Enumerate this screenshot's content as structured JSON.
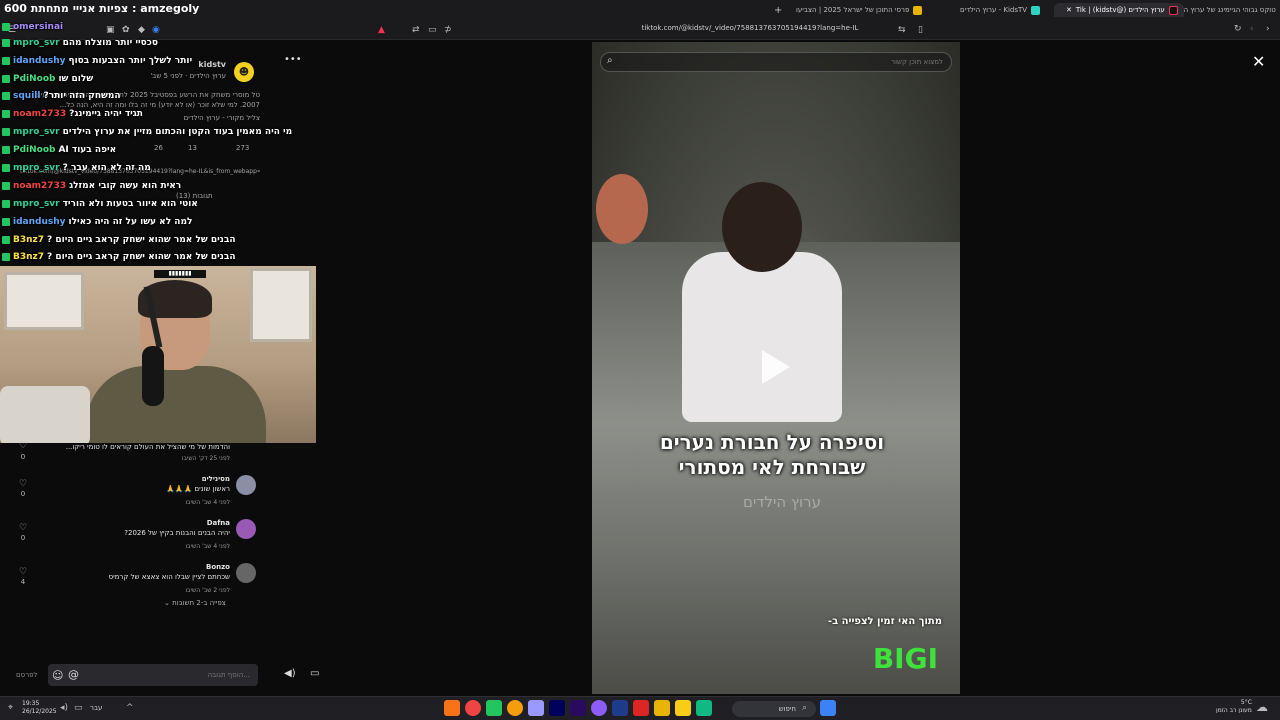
{
  "browser": {
    "stream_title": "amzegoly : צפיות אנייי מתחתת 600",
    "tabs": [
      {
        "label": "טוקס גבוהי הגיימינג של ערוץ הילדים"
      },
      {
        "label": "ערוץ הילדים (@kidstv) | Tik",
        "active": true
      },
      {
        "label": "KidsTV - ערוץ הילדים"
      },
      {
        "label": "פרסי התוכן של ישראל 2025 | הצביעו"
      }
    ],
    "new_tab": "+",
    "url": "tiktok.com/@kidstv/_video/758813763705194419?lang=he-IL"
  },
  "chat": [
    {
      "user": "omersinai",
      "text": "",
      "color": "#a78bfa"
    },
    {
      "user": "mpro_svr",
      "text": "סכסיי יותר מוצלח מהם",
      "color": "#34d399"
    },
    {
      "user": "idandushy",
      "text": "יותר לשלך יותר הצבעות בסוף",
      "color": "#60a5fa"
    },
    {
      "user": "PdiNoob",
      "text": "שלום שו",
      "color": "#4ade80"
    },
    {
      "user": "squill",
      "text": "המשחק הזה יותר?",
      "color": "#60a5fa"
    },
    {
      "user": "noam2733",
      "text": "תגיד יהיה גיימינג?",
      "color": "#ef4444"
    },
    {
      "user": "mpro_svr",
      "text": "מי היה מאמין בעוד הקטן והכתום מזיין את ערוץ הילדים",
      "color": "#34d399"
    },
    {
      "user": "PdiNoob",
      "text": "איפה בעוד AI",
      "color": "#4ade80"
    },
    {
      "user": "mpro_svr",
      "text": "מה זה לא הוא עבר ?",
      "color": "#34d399"
    },
    {
      "user": "noam2733",
      "text": "ראית הוא עשה קובי אמזלג",
      "color": "#ef4444"
    },
    {
      "user": "mpro_svr",
      "text": "אוטי הוא איוור בטעות ולא הוריד",
      "color": "#34d399"
    },
    {
      "user": "idandushy",
      "text": "למה לא עשו על זה היה כאילו",
      "color": "#60a5fa"
    },
    {
      "user": "B3nz7",
      "text": "הבנים של אמר שהוא ישחק קראב גיים היום ?",
      "color": "#fde047"
    },
    {
      "user": "B3nz7",
      "text": "הבנים של אמר שהוא ישחק קראב גיים היום ?",
      "color": "#fde047"
    }
  ],
  "description": {
    "account": "kidstv",
    "subtitle": "ערוץ הילדים · לפני 5 שב'",
    "text": "טל מוסרי משחק את הרשע בפסטיבל 2025 לתוך תוכנית הטלוויזיה ואירועים 2007. למי שלא זוכר (או לא יודע) מי זה בלו ומה זה היא, הנה כל...",
    "sound": "צליל מקורי - ערוץ הילדים",
    "likes": "273",
    "comments": "13",
    "saves": "26",
    "link": "tiktok.com/@kidstv_video/758813763705194419?lang=he-IL&is_from_webapp=1&sender_device=pc&web_id=7475487239276381701",
    "comments_header": "תגובות (13)",
    "more": "•••"
  },
  "webcam_label": "▮▮▮▮▮▮▮",
  "comments": [
    {
      "name": "",
      "text": "והדמות של מי שהציל את העולם קוראים לו טומי ריקו...",
      "meta": "לפני 25 דק'  השיבו",
      "likes": "0",
      "avatar": "#777"
    },
    {
      "name": "מסינילים",
      "text": "ראשון שונים 🙏🙏🙏",
      "meta": "לפני 4 שב'  השיבו",
      "likes": "0",
      "avatar": "#8b8fa6"
    },
    {
      "name": "Dafna",
      "text": "יהיה הבנים והבנות בקיץ של 2026?",
      "meta": "לפני 4 שב'  השיבו",
      "likes": "0",
      "avatar": "#9b59b6"
    },
    {
      "name": "Bonzo",
      "text": "שכחתם לציין שבלו הוא צאצא של קרמיס",
      "meta": "לפני 2 שב'  השיבו",
      "likes": "4",
      "avatar": "#666"
    }
  ],
  "view_replies": "צפייה ב-2 תשובות ⌄",
  "comment_bar": {
    "post": "לפרסם",
    "placeholder": "הוסף תגובה...",
    "emoji": "☺",
    "at": "@"
  },
  "video": {
    "caption": "וסיפרה על חבורת נערים שבורחת לאי מסתורי",
    "watermark": "ערוץ הילדים",
    "promo": "מתוך האי זמין לצפייה ב-",
    "bigi": "BIGI",
    "search_placeholder": "למצוא תוכן קשור"
  },
  "taskbar": {
    "time": "19:35",
    "date": "26/12/2025",
    "lang": "עבר",
    "search": "חיפוש",
    "weather_temp": "5°C",
    "weather_desc": "מעונן רב הזמן"
  },
  "colors": {
    "accent": "#3de23b",
    "tiktok_red": "#fe2c55"
  }
}
